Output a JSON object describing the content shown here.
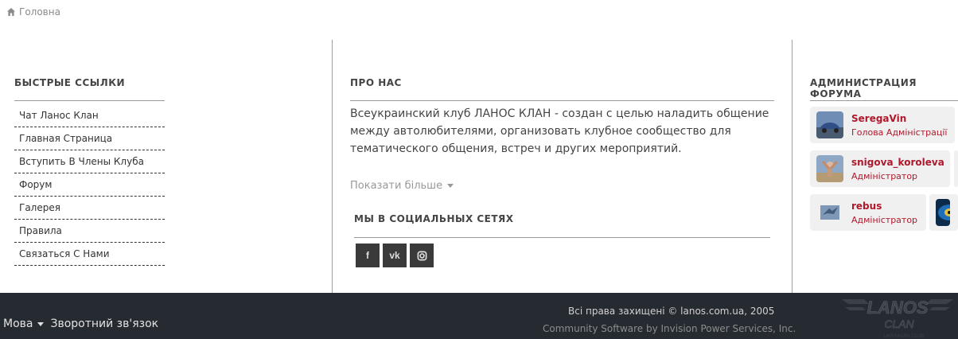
{
  "breadcrumb": {
    "home_label": "Головна"
  },
  "quick_links": {
    "title": "БЫСТРЫЕ ССЫЛКИ",
    "items": [
      "Чат Ланос Клан",
      "Главная Страница",
      "Вступить В Члены Клуба",
      "Форум",
      "Галерея",
      "Правила",
      "Связаться С Нами"
    ]
  },
  "about": {
    "title": "ПРО НАС",
    "text": "Всеукраинский клуб ЛАНОС КЛАН - создан с целью наладить общение между автолюбителями, организовать клубное сообщество для тематического общения, встреч и других мероприятий.",
    "show_more": "Показати більше"
  },
  "social": {
    "title": "МЫ В СОЦИАЛЬНЫХ СЕТЯХ",
    "icons": [
      "facebook-icon",
      "vk-icon",
      "instagram-icon"
    ],
    "facebook_glyph": "f",
    "vk_glyph": "vk"
  },
  "admin": {
    "title": "АДМИНИСТРАЦИЯ ФОРУМА",
    "members": [
      {
        "name": "SeregaVin",
        "role": "Голова Адміністрації"
      },
      {
        "name": "snigova_koroleva",
        "role": "Адміністратор"
      },
      {
        "name": "rebus",
        "role": "Адміністратор"
      }
    ]
  },
  "footer": {
    "language": "Мова",
    "feedback": "Зворотний зв'язок",
    "copyright": "Всі права захищені © lanos.com.ua, 2005",
    "community": "Community Software by Invision Power Services, Inc.",
    "logo_text": "LANOS",
    "logo_sub": "CLAN",
    "logo_tag": "UKRAINIAN CLUB"
  },
  "colors": {
    "accent_red": "#b0182b",
    "footer_bg": "#262a31",
    "social_btn": "#3a3a3a"
  }
}
